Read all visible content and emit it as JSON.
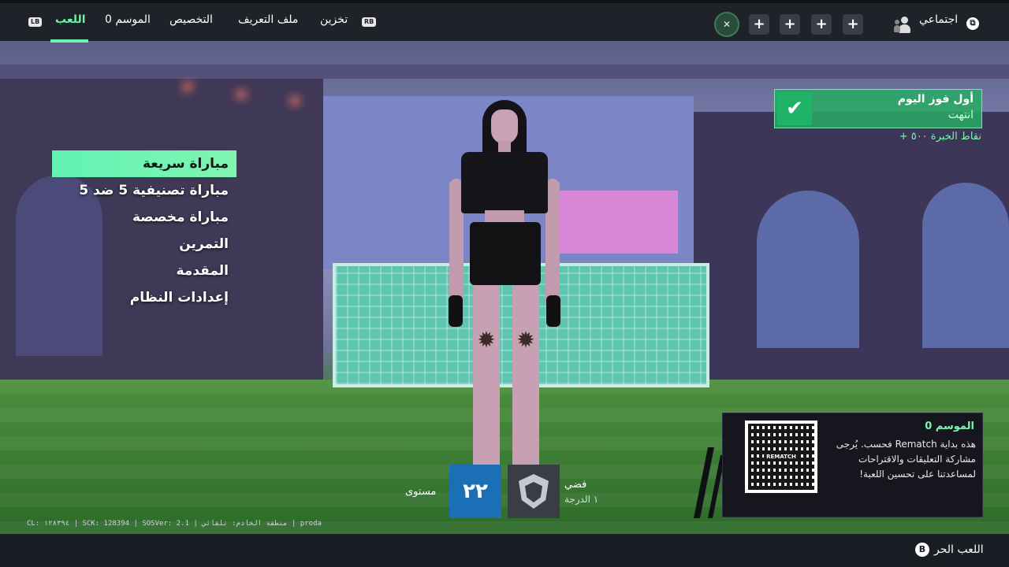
{
  "topbar": {
    "lb": "LB",
    "rb": "RB",
    "tabs": [
      "اللعب",
      "الموسم 0",
      "التخصيص",
      "ملف التعريف",
      "تخزين"
    ],
    "social_label": "اجتماعي",
    "plus": "+",
    "mute": "✕"
  },
  "menu": {
    "items": [
      "مباراة سريعة",
      "مباراة تصنيفية 5 ضد 5",
      "مباراة مخصصة",
      "التمرين",
      "المقدمة",
      "إعدادات النظام"
    ]
  },
  "challenge": {
    "title": "أول فوز اليوم",
    "status": "انتهت",
    "reward": "نقاط الخبرة ٥٠٠ +",
    "check": "✔"
  },
  "season": {
    "title": "الموسم 0",
    "body": "هذه بداية Rematch فحسب. يُرجى مشاركة التعليقات والاقتراحات لمساعدتنا على تحسين اللعبة!",
    "qr_label": "REMATCH"
  },
  "player_card": {
    "level": "٢٢",
    "level_label": "مستوى",
    "rank_name": "فضي",
    "rank_tier": "١ الدرجة"
  },
  "debug": "CL: ١٢٨٣٩٤ | SCK: 128394 | SOSVer: 2.1 | منطقة الخادم: تلقائي | proda",
  "bottombar": {
    "button": "B",
    "label": "اللعب الحر"
  },
  "colors": {
    "accent": "#6ef0a8",
    "level_blue": "#1a6fb5",
    "challenge_green": "#28aa64"
  }
}
